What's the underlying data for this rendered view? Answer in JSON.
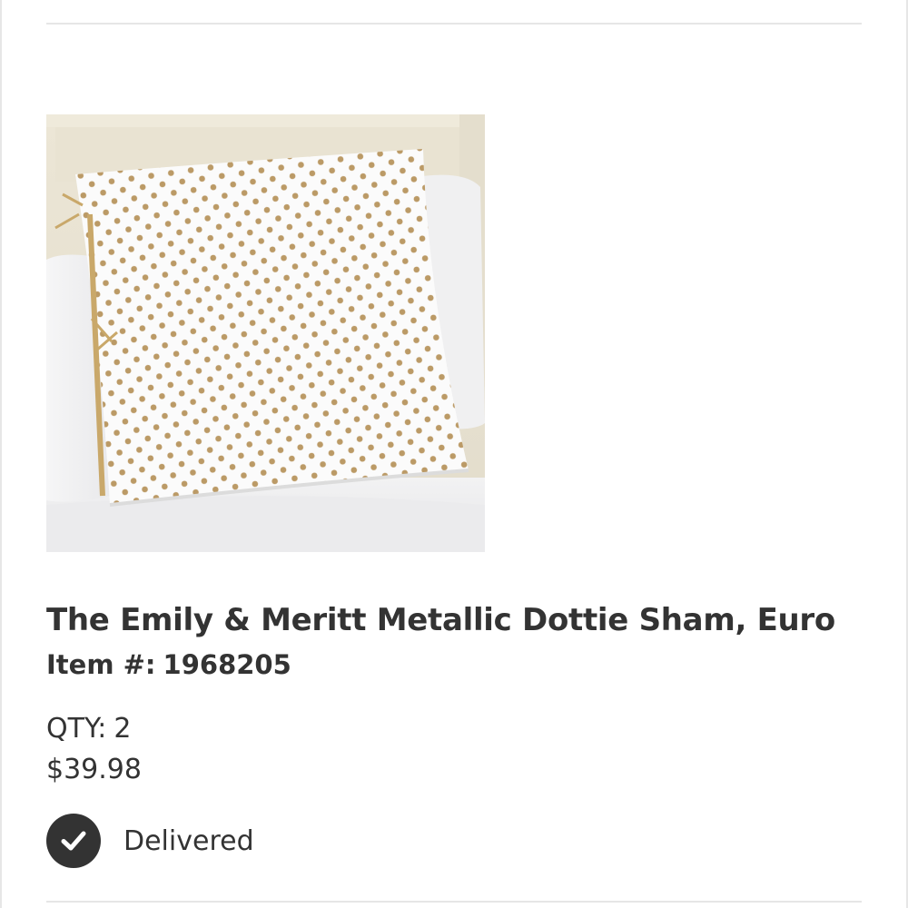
{
  "product": {
    "title": "The Emily & Meritt Metallic Dottie Sham, Euro",
    "item_label": "Item #:",
    "item_number": "1968205",
    "qty_label": "QTY:",
    "qty_value": "2",
    "price": "$39.98",
    "image_icon": "product-photo",
    "image_alt": "The Emily & Meritt Metallic Dottie Sham, Euro"
  },
  "status": {
    "text": "Delivered",
    "icon": "check-circle-icon"
  },
  "colors": {
    "text": "#333333",
    "divider": "#e6e6e6",
    "status_icon_bg": "#333333",
    "dot_gold": "#b8955e"
  }
}
